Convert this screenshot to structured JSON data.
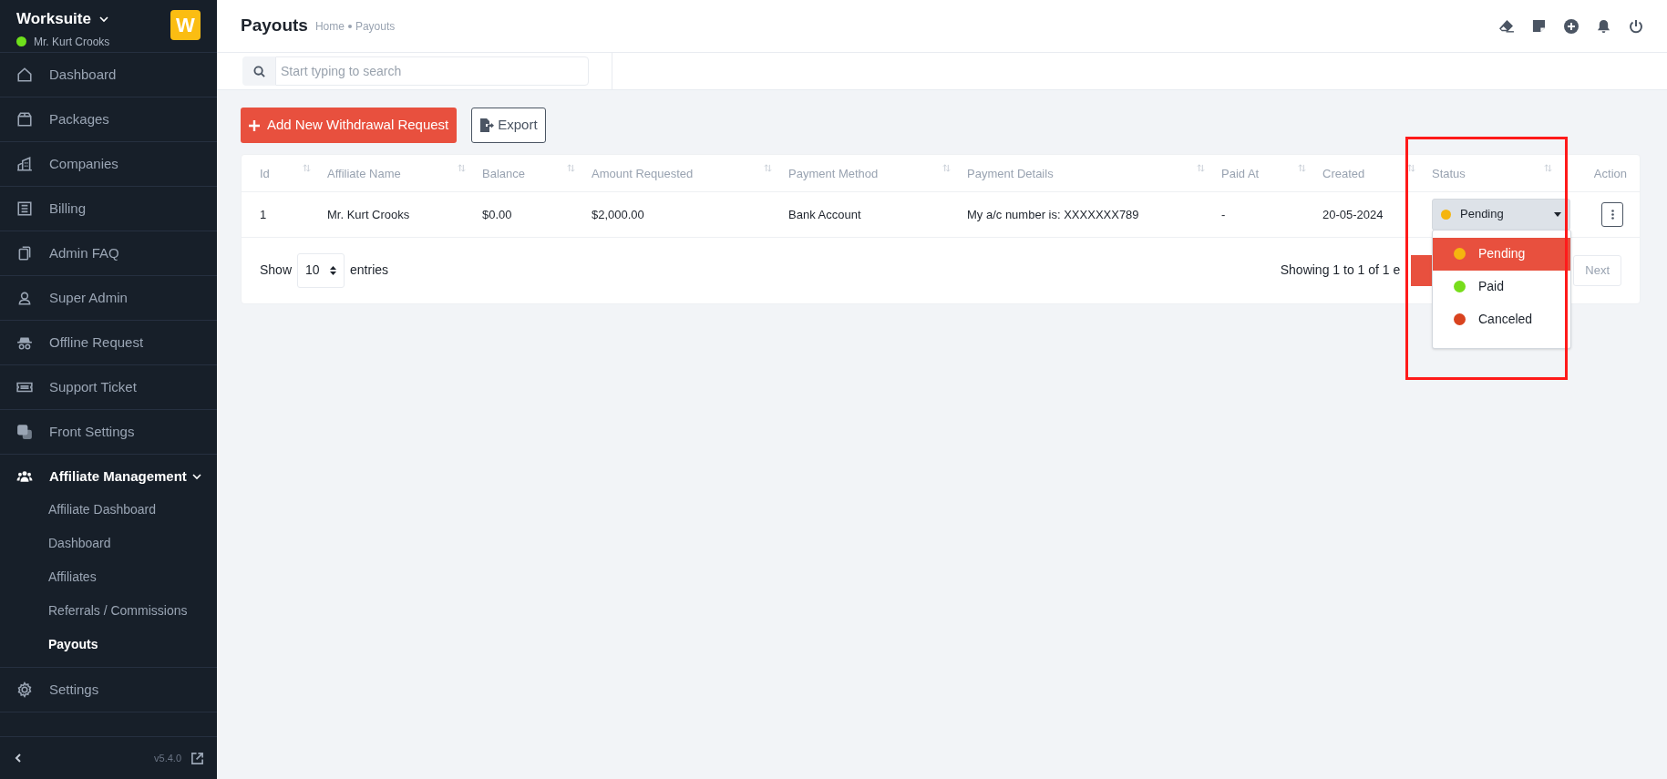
{
  "sidebar": {
    "brand": "Worksuite",
    "user": "Mr. Kurt Crooks",
    "user_online": true,
    "logo_letter": "W",
    "items": [
      {
        "label": "Dashboard",
        "selected": false
      },
      {
        "label": "Packages",
        "selected": false
      },
      {
        "label": "Companies",
        "selected": false
      },
      {
        "label": "Billing",
        "selected": false
      },
      {
        "label": "Admin FAQ",
        "selected": false
      },
      {
        "label": "Super Admin",
        "selected": false
      },
      {
        "label": "Offline Request",
        "selected": false
      },
      {
        "label": "Support Ticket",
        "selected": false
      },
      {
        "label": "Front Settings",
        "selected": false
      },
      {
        "label": "Affiliate Management",
        "selected": true,
        "expanded": true,
        "children": [
          {
            "label": "Affiliate Dashboard",
            "selected": false
          },
          {
            "label": "Dashboard",
            "selected": false
          },
          {
            "label": "Affiliates",
            "selected": false
          },
          {
            "label": "Referrals / Commissions",
            "selected": false
          },
          {
            "label": "Payouts",
            "selected": true
          }
        ]
      },
      {
        "label": "Settings",
        "selected": false
      }
    ],
    "version": "v5.4.0"
  },
  "header": {
    "title": "Payouts",
    "breadcrumb": [
      "Home",
      "Payouts"
    ]
  },
  "search": {
    "placeholder": "Start typing to search"
  },
  "actions": {
    "add_button": "Add New Withdrawal Request",
    "export_button": "Export"
  },
  "table": {
    "columns": [
      {
        "label": "Id",
        "sortable": true
      },
      {
        "label": "Affiliate Name",
        "sortable": true
      },
      {
        "label": "Balance",
        "sortable": true
      },
      {
        "label": "Amount Requested",
        "sortable": true
      },
      {
        "label": "Payment Method",
        "sortable": true
      },
      {
        "label": "Payment Details",
        "sortable": true
      },
      {
        "label": "Paid At",
        "sortable": true
      },
      {
        "label": "Created",
        "sortable": true
      },
      {
        "label": "Status",
        "sortable": true
      },
      {
        "label": "Action",
        "sortable": false
      }
    ],
    "rows": [
      {
        "cells": [
          "1",
          "Mr. Kurt Crooks",
          "$0.00",
          "$2,000.00",
          "Bank Account",
          "My a/c number is: XXXXXXX789",
          "-",
          "20-05-2024"
        ],
        "status": "Pending"
      }
    ]
  },
  "status_menu": {
    "open": true,
    "options": [
      {
        "label": "Pending",
        "color": "#f5b50f",
        "selected": true
      },
      {
        "label": "Paid",
        "color": "#77dd1b",
        "selected": false
      },
      {
        "label": "Canceled",
        "color": "#d9431f",
        "selected": false
      }
    ]
  },
  "footer": {
    "show_label": "Show",
    "page_size": "10",
    "entries_label": "entries",
    "info": "Showing 1 to 1 of 1 e",
    "next": "Next"
  }
}
